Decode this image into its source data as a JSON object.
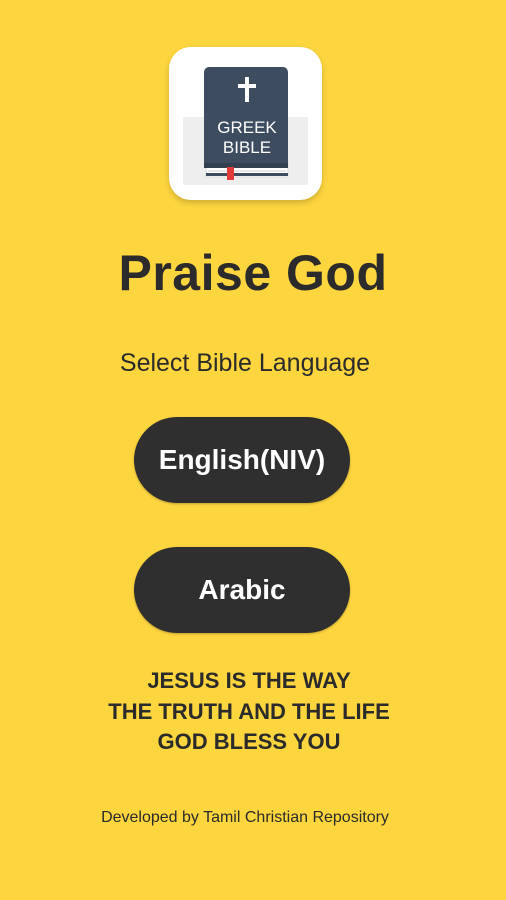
{
  "colors": {
    "background": "#FDD53F",
    "button": "#2F2F2F",
    "button_text": "#FFFFFF",
    "text": "#2B2B2B",
    "book_cover": "#3D4C5E",
    "bookmark": "#E03A3A"
  },
  "app_icon": {
    "icon": "greek-bible-book-icon",
    "cross": "✝",
    "line1": "GREEK",
    "line2": "BIBLE"
  },
  "title": "Praise God",
  "subtitle": "Select Bible Language",
  "buttons": {
    "english": "English(NIV)",
    "arabic": "Arabic"
  },
  "verse": {
    "line1": "JESUS IS THE WAY",
    "line2": "THE TRUTH AND THE LIFE",
    "line3": "GOD BLESS YOU"
  },
  "footer": "Developed by Tamil Christian Repository"
}
